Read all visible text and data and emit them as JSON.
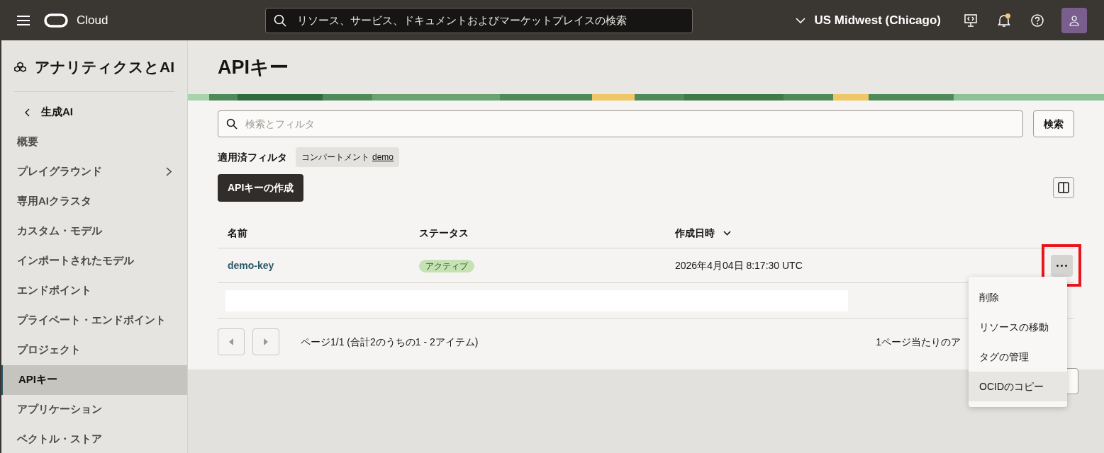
{
  "header": {
    "brand": "Cloud",
    "search": {
      "placeholder": "リソース、サービス、ドキュメントおよびマーケットプレイスの検索"
    },
    "region": "US Midwest (Chicago)",
    "notification_badge": true
  },
  "sidebar": {
    "title": "アナリティクスとAI",
    "back": "生成AI",
    "items": [
      {
        "label": "概要",
        "selected": false,
        "expandable": false
      },
      {
        "label": "プレイグラウンド",
        "selected": false,
        "expandable": true
      },
      {
        "label": "専用AIクラスタ",
        "selected": false,
        "expandable": false
      },
      {
        "label": "カスタム・モデル",
        "selected": false,
        "expandable": false
      },
      {
        "label": "インポートされたモデル",
        "selected": false,
        "expandable": false
      },
      {
        "label": "エンドポイント",
        "selected": false,
        "expandable": false
      },
      {
        "label": "プライベート・エンドポイント",
        "selected": false,
        "expandable": false
      },
      {
        "label": "プロジェクト",
        "selected": false,
        "expandable": false
      },
      {
        "label": "APIキー",
        "selected": true,
        "expandable": false
      },
      {
        "label": "アプリケーション",
        "selected": false,
        "expandable": false
      },
      {
        "label": "ベクトル・ストア",
        "selected": false,
        "expandable": false
      }
    ]
  },
  "page": {
    "title": "APIキー",
    "search": {
      "placeholder": "検索とフィルタ",
      "button": "検索"
    },
    "filters": {
      "label": "適用済フィルタ",
      "chips": [
        {
          "name": "コンパートメント",
          "value": "demo"
        }
      ]
    },
    "create_button": "APIキーの作成",
    "table": {
      "columns": [
        {
          "label": "名前",
          "sorted": false
        },
        {
          "label": "ステータス",
          "sorted": false
        },
        {
          "label": "作成日時",
          "sorted": true
        }
      ],
      "rows": [
        {
          "name": "demo-key",
          "status": "アクティブ",
          "created": "2026年4月04日 8:17:30 UTC",
          "highlighted": true
        }
      ]
    },
    "pagination": {
      "summary": "ページ1/1 (合計2のうちの1 - 2アイテム)",
      "per_page_label": "1ページ当たりのア"
    },
    "action_menu": [
      {
        "label": "削除",
        "selected": false
      },
      {
        "label": "リソースの移動",
        "selected": false
      },
      {
        "label": "タグの管理",
        "selected": false
      },
      {
        "label": "OCIDのコピー",
        "selected": true
      }
    ]
  }
}
